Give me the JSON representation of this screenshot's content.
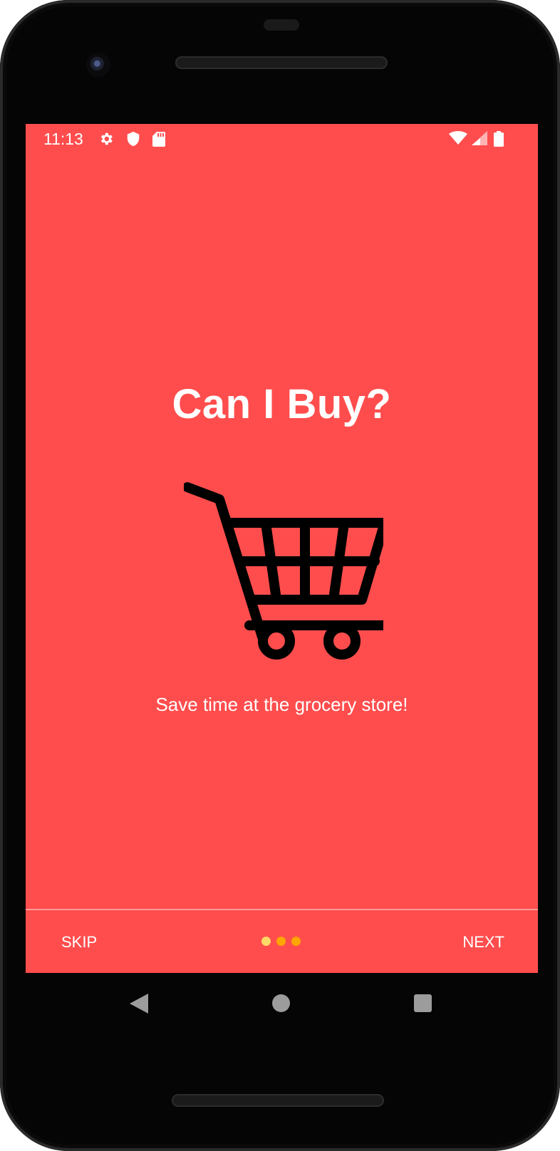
{
  "status_bar": {
    "time": "11:13",
    "left_icons": [
      "settings-gear-icon",
      "shield-icon",
      "sd-card-icon"
    ],
    "right_icons": [
      "wifi-icon",
      "cell-signal-icon",
      "battery-icon"
    ]
  },
  "onboarding": {
    "title": "Can I Buy?",
    "illustration": "shopping-cart-icon",
    "subtitle": "Save time at the grocery store!",
    "skip_label": "SKIP",
    "next_label": "NEXT",
    "page_indicator": {
      "total": 3,
      "current": 1,
      "active_color": "#ffd966",
      "inactive_color": "#ffa500"
    }
  },
  "navigation_bar": {
    "buttons": [
      "back-icon",
      "home-icon",
      "recents-icon"
    ]
  },
  "colors": {
    "background": "#ff4d4d",
    "text": "#ffffff",
    "bezel": "#050505"
  }
}
